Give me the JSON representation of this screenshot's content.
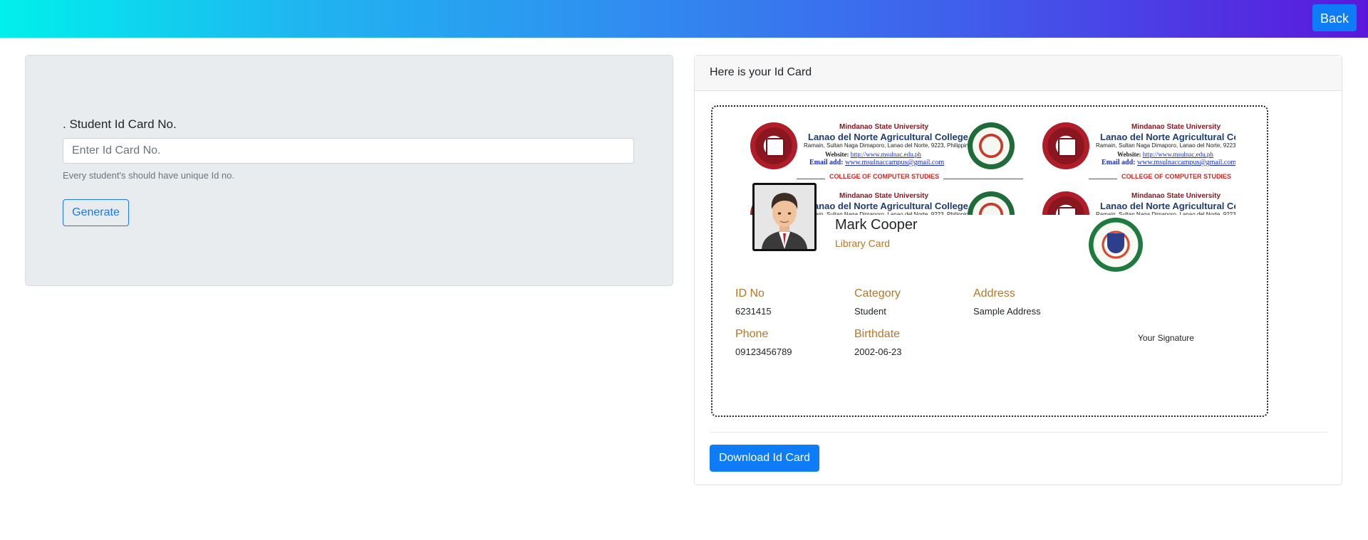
{
  "header": {
    "back_label": "Back"
  },
  "form": {
    "label": ". Student Id Card No.",
    "input_placeholder": "Enter Id Card No.",
    "input_value": "",
    "help_text": "Every student's should have unique Id no.",
    "generate_label": "Generate"
  },
  "card_panel": {
    "header": "Here is your Id Card",
    "download_label": "Download Id Card"
  },
  "banner": {
    "university": "Mindanao State University",
    "college": "Lanao del Norte Agricultural College",
    "address": "Ramain, Sultan Naga Dimaporo, Lanao del Norte, 9223, Philippines",
    "website_label": "Website:",
    "website": "http://www.msulnac.edu.ph",
    "email_label": "Email add:",
    "email": "www.msulnaccampus@gmail.com",
    "department": "COLLEGE OF COMPUTER STUDIES"
  },
  "id_card": {
    "name": "Mark Cooper",
    "card_type": "Library Card",
    "fields": {
      "id_no": {
        "label": "ID No",
        "value": "6231415"
      },
      "category": {
        "label": "Category",
        "value": "Student"
      },
      "address": {
        "label": "Address",
        "value": "Sample Address"
      },
      "phone": {
        "label": "Phone",
        "value": "09123456789"
      },
      "birthdate": {
        "label": "Birthdate",
        "value": "2002-06-23"
      }
    },
    "signature_label": "Your Signature"
  },
  "colors": {
    "primary": "#0d7cf6",
    "accent_label": "#b5762a",
    "form_bg": "#e9ecef"
  }
}
